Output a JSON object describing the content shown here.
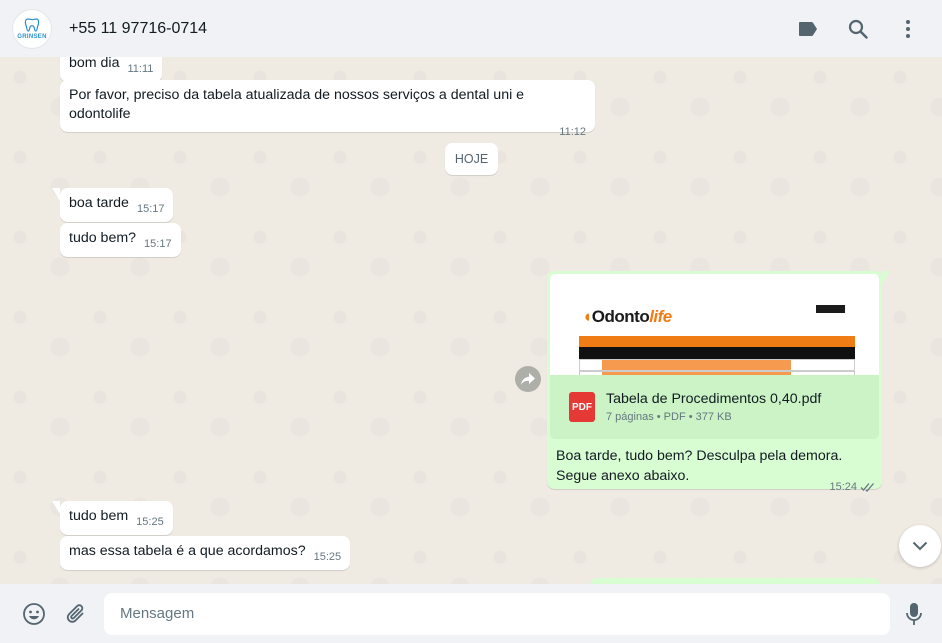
{
  "header": {
    "contact_name": "+55 11 97716-0714",
    "avatar_text": "GRINSEN"
  },
  "messages": [
    {
      "text": "bom dia",
      "time": "11:11"
    },
    {
      "text": "Por favor, preciso da tabela atualizada de nossos serviços a dental uni e odontolife",
      "time": "11:12"
    },
    {
      "text": "boa tarde",
      "time": "15:17"
    },
    {
      "text": "tudo bem?",
      "time": "15:17"
    },
    {
      "text": "tudo bem",
      "time": "15:25"
    },
    {
      "text": "mas essa tabela é a que acordamos?",
      "time": "15:25"
    }
  ],
  "date_separator": "HOJE",
  "outgoing": {
    "preview_logo_odonto": "Odonto",
    "preview_logo_life": "life",
    "file_icon_label": "PDF",
    "file_name": "Tabela de Procedimentos 0,40.pdf",
    "file_meta": "7 páginas • PDF • 377 KB",
    "caption_line1": "Boa tarde, tudo bem? Desculpa pela demora.",
    "caption_line2": "Segue anexo abaixo.",
    "time": "15:24"
  },
  "composer": {
    "placeholder": "Mensagem"
  },
  "colors": {
    "header_bg": "#f0f2f5",
    "chat_bg": "#efeae2",
    "incoming_bubble": "#ffffff",
    "outgoing_bubble": "#d9fdd3",
    "pdf_red": "#e53935",
    "read_check": "#667781"
  },
  "icons": [
    "tooth-logo-icon",
    "label-icon",
    "search-icon",
    "menu-dots-icon",
    "forward-icon",
    "chevron-down-icon",
    "emoji-icon",
    "attach-icon",
    "mic-icon",
    "double-check-icon"
  ]
}
